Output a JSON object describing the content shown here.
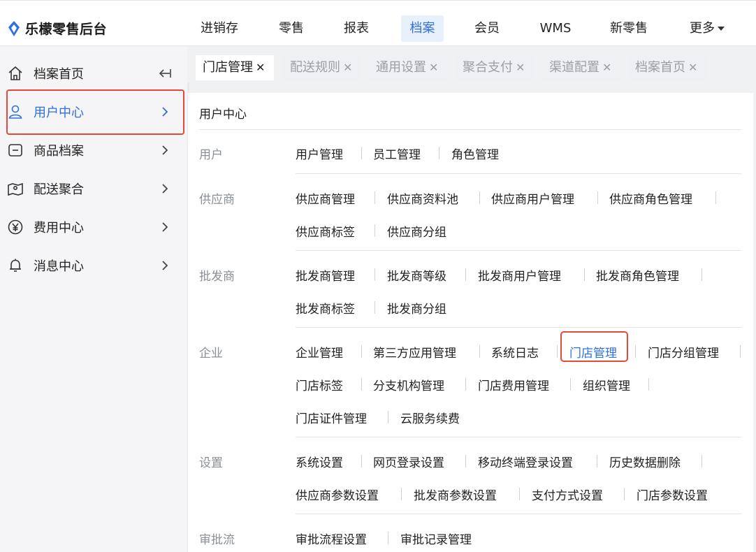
{
  "app": {
    "name": "乐檬零售后台"
  },
  "topnav": [
    {
      "label": "进销存"
    },
    {
      "label": "零售"
    },
    {
      "label": "报表"
    },
    {
      "label": "档案",
      "active": true
    },
    {
      "label": "会员"
    },
    {
      "label": "WMS"
    },
    {
      "label": "新零售"
    },
    {
      "label": "更多"
    }
  ],
  "sidebar": {
    "items": [
      {
        "label": "档案首页",
        "icon": "home-icon"
      },
      {
        "label": "用户中心",
        "icon": "user-icon",
        "active": true
      },
      {
        "label": "商品档案",
        "icon": "goods-icon"
      },
      {
        "label": "配送聚合",
        "icon": "map-icon"
      },
      {
        "label": "费用中心",
        "icon": "yen-icon"
      },
      {
        "label": "消息中心",
        "icon": "bell-icon"
      }
    ]
  },
  "tabs": [
    {
      "label": "门店管理",
      "active": true
    },
    {
      "label": "配送规则"
    },
    {
      "label": "通用设置"
    },
    {
      "label": "聚合支付"
    },
    {
      "label": "渠道配置"
    },
    {
      "label": "档案首页"
    }
  ],
  "panel": {
    "title": "用户中心",
    "groups": [
      {
        "label": "用户",
        "rows": [
          [
            "用户管理",
            "员工管理",
            "角色管理"
          ]
        ]
      },
      {
        "label": "供应商",
        "rows": [
          [
            "供应商管理",
            "供应商资料池",
            "供应商用户管理",
            "供应商角色管理"
          ],
          [
            "供应商标签",
            "供应商分组"
          ]
        ]
      },
      {
        "label": "批发商",
        "rows": [
          [
            "批发商管理",
            "批发商等级",
            "批发商用户管理",
            "批发商角色管理"
          ],
          [
            "批发商标签",
            "批发商分组"
          ]
        ]
      },
      {
        "label": "企业",
        "rows": [
          [
            "企业管理",
            "第三方应用管理",
            "系统日志",
            "门店管理",
            "门店分组管理"
          ],
          [
            "门店标签",
            "分支机构管理",
            "门店费用管理",
            "组织管理"
          ],
          [
            "门店证件管理",
            "云服务续费"
          ]
        ]
      },
      {
        "label": "设置",
        "rows": [
          [
            "系统设置",
            "网页登录设置",
            "移动终端登录设置",
            "历史数据删除"
          ],
          [
            "供应商参数设置",
            "批发商参数设置",
            "支付方式设置",
            "门店参数设置"
          ]
        ]
      },
      {
        "label": "审批流",
        "rows": [
          [
            "审批流程设置",
            "审批记录管理"
          ]
        ]
      }
    ]
  },
  "colors": {
    "accent": "#2f6fe0",
    "highlight": "#e24a3b"
  }
}
